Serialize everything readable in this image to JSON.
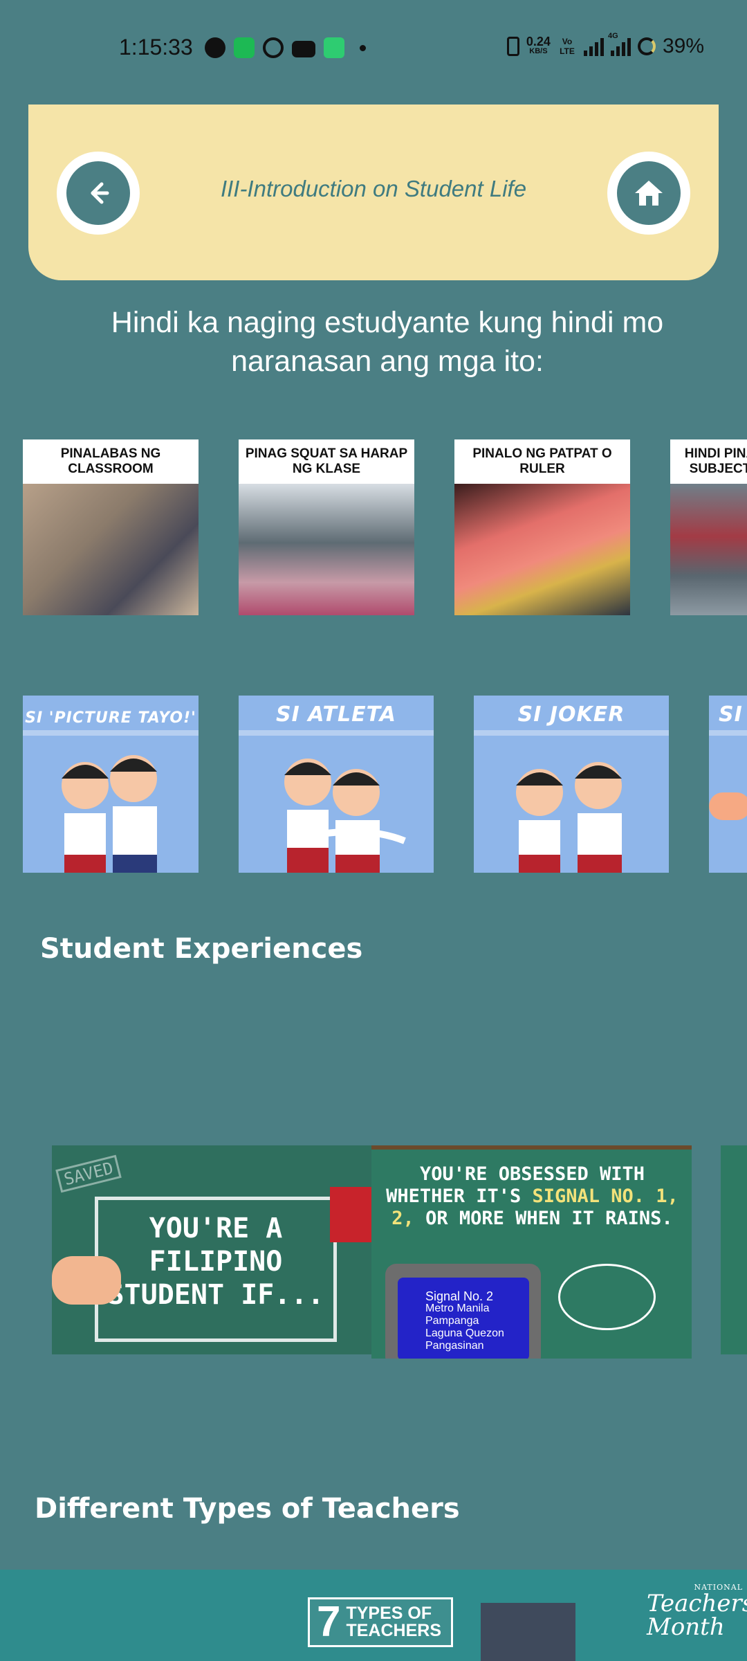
{
  "status_bar": {
    "time": "1:15:33",
    "network_speed": "0.24",
    "network_unit": "KB/S",
    "volte": "Vo LTE",
    "signal_type": "4G",
    "battery": "39%",
    "icons": [
      "messenger-icon",
      "spotify-icon",
      "google-icon",
      "youtube-icon",
      "battery-saver-icon",
      "vibrate-icon",
      "signal-icon",
      "battery-icon"
    ]
  },
  "header": {
    "title": "III-Introduction on Student Life",
    "back_icon": "arrow-left-icon",
    "home_icon": "home-icon",
    "background": "#f5e4a8",
    "accent": "#4b7f84"
  },
  "intro_text": "Hindi ka naging estudyante kung hindi mo naranasan ang mga ito:",
  "experience_cards": [
    {
      "caption": "PINALABAS NG CLASSROOM"
    },
    {
      "caption": "PINAG SQUAT SA HARAP NG KLASE"
    },
    {
      "caption": "PINALO NG PATPAT O RULER"
    },
    {
      "caption": "HINDI PINA SUBJECT"
    }
  ],
  "student_type_cards": [
    {
      "title": "SI 'PICTURE TAYO!'"
    },
    {
      "title": "SI ATLETA"
    },
    {
      "title": "SI JOKER"
    },
    {
      "title": "SI"
    }
  ],
  "sections": {
    "student_experiences": "Student Experiences",
    "teachers": "Different Types of Teachers"
  },
  "slides": {
    "first": {
      "stamp": "SAVED",
      "text": "YOU'RE A FILIPINO STUDENT IF..."
    },
    "second": {
      "text_a": "YOU'RE OBSESSED WITH WHETHER IT'S",
      "text_highlight": "SIGNAL NO. 1, 2,",
      "text_b": "OR MORE WHEN IT RAINS.",
      "tv_title": "Signal No. 2",
      "tv_lines": "Metro Manila Pampanga Laguna Quezon Pangasinan"
    }
  },
  "banner": {
    "number": "7",
    "label": "TYPES OF TEACHERS",
    "mark_small": "NATIONAL",
    "mark": "Teachers' Month"
  }
}
